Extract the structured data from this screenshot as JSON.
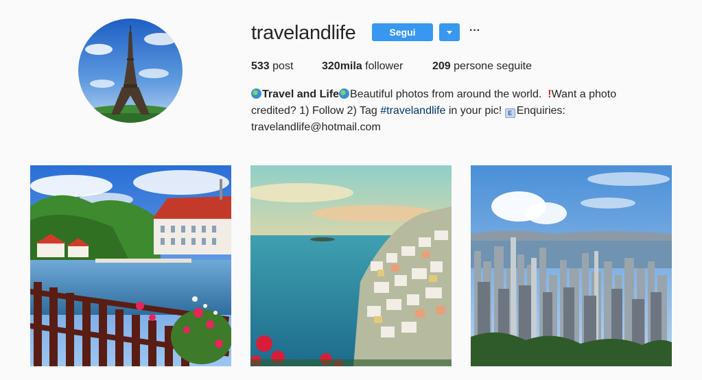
{
  "profile": {
    "username": "travelandlife",
    "avatar_icon": "eiffel-tower-photo",
    "follow_label": "Segui",
    "dropdown_icon": "caret-down-icon",
    "more_label": "···",
    "accent_color": "#3897f0"
  },
  "stats": {
    "posts_count": "533",
    "posts_label": "post",
    "followers_count": "320mila",
    "followers_label": "follower",
    "following_count": "209",
    "following_label": "persone seguite"
  },
  "bio": {
    "name": "Travel and Life",
    "text1": "Beautiful photos from around the world.",
    "text2": "Want a photo",
    "text3": "credited? 1) Follow 2) Tag",
    "hashtag": "#travelandlife",
    "text4": "in your pic!",
    "mail_icon_letter": "E",
    "text5": "Enquiries:",
    "email": "travelandlife@hotmail.com"
  },
  "posts": [
    {
      "icon": "castle-lake-photo"
    },
    {
      "icon": "coastal-town-photo"
    },
    {
      "icon": "city-skyline-photo"
    }
  ]
}
